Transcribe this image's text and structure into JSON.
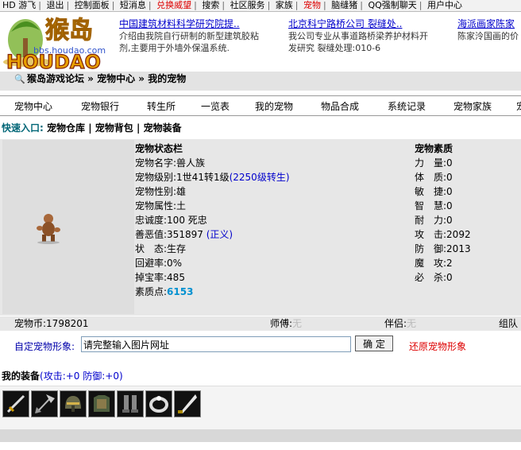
{
  "top_nav": [
    "HD 游飞",
    "退出",
    "控制面板",
    "短消息",
    "兑换威望",
    "搜索",
    "社区服务",
    "家族",
    "宠物",
    "脑缝猪",
    "QQ强制聊天",
    "用户中心"
  ],
  "logo": {
    "text": "HOUDAO",
    "cn": "猴岛",
    "url": "bbs.houdao.com"
  },
  "ads": [
    {
      "title": "中国建筑材料科学研究院提..",
      "line1": "介绍由我院自行研制的新型建筑胶粘",
      "line2": "剂,主要用于外墙外保温系统."
    },
    {
      "title": "北京科宁路桥公司 裂缝处..",
      "line1": "我公司专业从事道路桥梁养护材料开",
      "line2": "发研究 裂缝处理:010-6"
    },
    {
      "title": "海派画家陈家",
      "line1": "陈家泠国画的价",
      "line2": ""
    }
  ],
  "breadcrumb": "猴岛游戏论坛 » 宠物中心 » 我的宠物",
  "menu": [
    "宠物中心",
    "宠物银行",
    "转生所",
    "一览表",
    "我的宠物",
    "物品合成",
    "系统记录",
    "宠物家族",
    "宠"
  ],
  "quick": {
    "label": "快速入口:",
    "links": [
      "宠物仓库",
      "宠物背包",
      "宠物装备"
    ]
  },
  "status": {
    "title": "宠物状态栏",
    "name_label": "宠物名字:",
    "name": "兽人族",
    "level_label": "宠物级别:",
    "level": "1世41转1级",
    "level_link": "(2250级转生)",
    "gender_label": "宠物性别:",
    "gender": "雄",
    "attr_label": "宠物属性:",
    "attr": "土",
    "loyal_label": "忠诚度:",
    "loyal": "100 死忠",
    "good_label": "善恶值:",
    "good": "351897",
    "good_tag": "(正义)",
    "state_label": "状　态:",
    "state": "生存",
    "dodge_label": "回避率:",
    "dodge": "0%",
    "drop_label": "掉宝率:",
    "drop": "485",
    "points_label": "素质点:",
    "points": "6153"
  },
  "attrs": {
    "title": "宠物素质",
    "items": [
      {
        "label": "力　量:",
        "value": "0"
      },
      {
        "label": "体　质:",
        "value": "0"
      },
      {
        "label": "敏　捷:",
        "value": "0"
      },
      {
        "label": "智　慧:",
        "value": "0"
      },
      {
        "label": "耐　力:",
        "value": "0"
      },
      {
        "label": "攻　击:",
        "value": "2092"
      },
      {
        "label": "防　御:",
        "value": "2013"
      },
      {
        "label": "魔　攻:",
        "value": "2"
      },
      {
        "label": "必　杀:",
        "value": "0"
      }
    ]
  },
  "coin": {
    "label": "宠物币:",
    "value": "1798201",
    "master_label": "师傅:",
    "master": "无",
    "partner_label": "伴侣:",
    "partner": "无",
    "team": "组队"
  },
  "custom": {
    "label": "自定宠物形象:",
    "input_value": "请完整输入图片网址",
    "ok": "确 定",
    "restore": "还原宠物形象"
  },
  "equip": {
    "title": "我的装备",
    "stats": "(攻击:+0 防御:+0)",
    "icons": [
      "sword-icon",
      "axe-icon",
      "helmet-icon",
      "armor-icon",
      "boots-icon",
      "ring-icon",
      "blade-icon"
    ]
  },
  "colors": {
    "red": "#dd0000",
    "blue": "#0000cc",
    "panel": "#e7e7e7"
  }
}
